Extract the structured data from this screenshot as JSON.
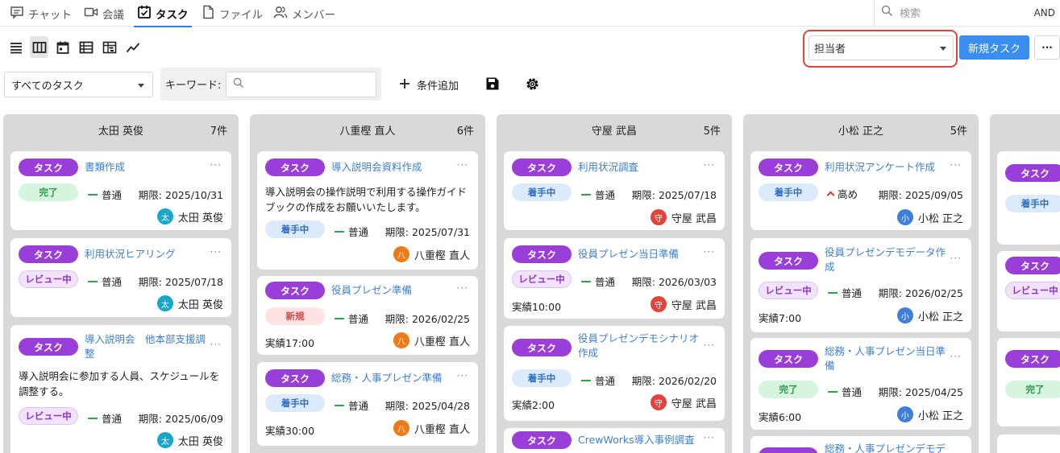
{
  "tabs": [
    {
      "label": "チャット",
      "icon": "chat-icon"
    },
    {
      "label": "会議",
      "icon": "video-icon"
    },
    {
      "label": "タスク",
      "icon": "task-check-icon",
      "active": true
    },
    {
      "label": "ファイル",
      "icon": "file-icon"
    },
    {
      "label": "メンバー",
      "icon": "members-icon"
    }
  ],
  "search": {
    "placeholder": "検索",
    "mode": "AND"
  },
  "toolbar": {
    "assignee_value": "担当者",
    "new_task_label": "新規タスク",
    "more_label": "···",
    "view_icons": [
      "list-view-icon",
      "board-view-icon",
      "calendar-view-icon",
      "table-view-icon",
      "gantt-view-icon",
      "chart-view-icon"
    ]
  },
  "filter": {
    "task_scope": "すべてのタスク",
    "keyword_label": "キーワード:",
    "keyword_value": "",
    "add_condition": "条件追加"
  },
  "colors": {
    "tag": "#9a3ed9",
    "accent": "#3a8ef0",
    "highlight": "#d3493e"
  },
  "columns": [
    {
      "name": "太田 英俊",
      "count": "7件",
      "cards": [
        {
          "tag": "タスク",
          "title": "書類作成",
          "status": "完了",
          "priority": "普通",
          "due": "期限: 2025/10/31",
          "owner": "太田 英俊",
          "avatar": "太"
        },
        {
          "tag": "タスク",
          "title": "利用状況ヒアリング",
          "status": "レビュー中",
          "priority": "普通",
          "due": "期限: 2025/07/18",
          "owner": "太田 英俊",
          "avatar": "太"
        },
        {
          "tag": "タスク",
          "title": "導入説明会　他本部支援調整",
          "desc": "導入説明会に参加する人員、スケジュールを調整する。",
          "status": "レビュー中",
          "priority": "普通",
          "due": "期限: 2025/06/09",
          "owner": "太田 英俊",
          "avatar": "太"
        }
      ]
    },
    {
      "name": "八重樫 直人",
      "count": "6件",
      "cards": [
        {
          "tag": "タスク",
          "title": "導入説明会資料作成",
          "desc": "導入説明会の操作説明で利用する操作ガイドブックの作成をお願いいたします。",
          "status": "着手中",
          "priority": "普通",
          "due": "期限: 2025/07/31",
          "owner": "八重樫 直人",
          "avatar": "八"
        },
        {
          "tag": "タスク",
          "title": "役員プレゼン準備",
          "status": "新規",
          "priority": "普通",
          "due": "期限: 2026/02/25",
          "actual": "実績17:00",
          "owner": "八重樫 直人",
          "avatar": "八"
        },
        {
          "tag": "タスク",
          "title": "総務・人事プレゼン準備",
          "status": "着手中",
          "priority": "普通",
          "due": "期限: 2025/04/28",
          "actual": "実績30:00",
          "owner": "八重樫 直人",
          "avatar": "八"
        }
      ]
    },
    {
      "name": "守屋 武昌",
      "count": "5件",
      "cards": [
        {
          "tag": "タスク",
          "title": "利用状況調査",
          "status": "着手中",
          "priority": "普通",
          "due": "期限: 2025/07/18",
          "owner": "守屋 武昌",
          "avatar": "守"
        },
        {
          "tag": "タスク",
          "title": "役員プレゼン当日準備",
          "status": "レビュー中",
          "priority": "普通",
          "due": "期限: 2026/03/03",
          "actual": "実績10:00",
          "owner": "守屋 武昌",
          "avatar": "守"
        },
        {
          "tag": "タスク",
          "title": "役員プレゼンデモシナリオ作成",
          "status": "着手中",
          "priority": "普通",
          "due": "期限: 2026/02/20",
          "actual": "実績2:00",
          "owner": "守屋 武昌",
          "avatar": "守"
        },
        {
          "tag": "タスク",
          "title": "CrewWorks導入事例調査"
        }
      ]
    },
    {
      "name": "小松 正之",
      "count": "5件",
      "cards": [
        {
          "tag": "タスク",
          "title": "利用状況アンケート作成",
          "status": "着手中",
          "priority": "高め",
          "due": "期限: 2025/09/05",
          "owner": "小松 正之",
          "avatar": "小"
        },
        {
          "tag": "タスク",
          "title": "役員プレゼンデモデータ作成",
          "status": "レビュー中",
          "priority": "普通",
          "due": "期限: 2026/02/25",
          "actual": "実績7:00",
          "owner": "小松 正之",
          "avatar": "小"
        },
        {
          "tag": "タスク",
          "title": "総務・人事プレゼン当日準備",
          "status": "完了",
          "priority": "普通",
          "due": "期限: 2025/04/25",
          "actual": "実績6:00",
          "owner": "小松 正之",
          "avatar": "小"
        },
        {
          "tag": "",
          "title": "総務・人事プレゼンデモデ"
        }
      ]
    },
    {
      "name": "",
      "count": "",
      "cards": [
        {
          "tag": "タスク",
          "status": "着手中"
        },
        {
          "tag": "タスク",
          "status": "レビュー中"
        },
        {
          "tag": "タスク",
          "status": "完了"
        }
      ]
    }
  ]
}
